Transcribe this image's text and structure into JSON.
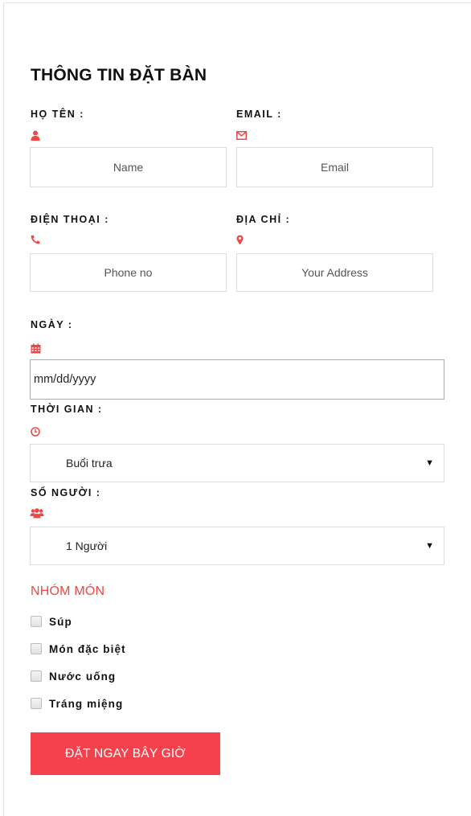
{
  "form": {
    "title": "THÔNG TIN ĐẶT BÀN",
    "name": {
      "label": "HỌ TÊN :",
      "placeholder": "Name",
      "icon": "user-icon"
    },
    "email": {
      "label": "EMAIL :",
      "placeholder": "Email",
      "icon": "envelope-icon"
    },
    "phone": {
      "label": "ĐIỆN THOẠI :",
      "placeholder": "Phone no",
      "icon": "phone-icon"
    },
    "address": {
      "label": "ĐỊA CHỈ :",
      "placeholder": "Your Address",
      "icon": "map-marker-icon"
    },
    "date": {
      "label": "NGÀY :",
      "value": "mm/dd/yyyy",
      "icon": "calendar-icon"
    },
    "time": {
      "label": "THỜI GIAN :",
      "selected": "Buổi trưa",
      "icon": "clock-icon"
    },
    "guests": {
      "label": "SỐ NGƯỜI :",
      "selected": "1 Người",
      "icon": "users-icon"
    },
    "dish_group": {
      "title": "NHÓM MÓN",
      "options": [
        "Súp",
        "Món đặc biệt",
        "Nước uống",
        "Tráng miệng"
      ]
    },
    "submit_label": "ĐẶT NGAY BÂY GIỜ",
    "accent_color": "#f04646"
  }
}
